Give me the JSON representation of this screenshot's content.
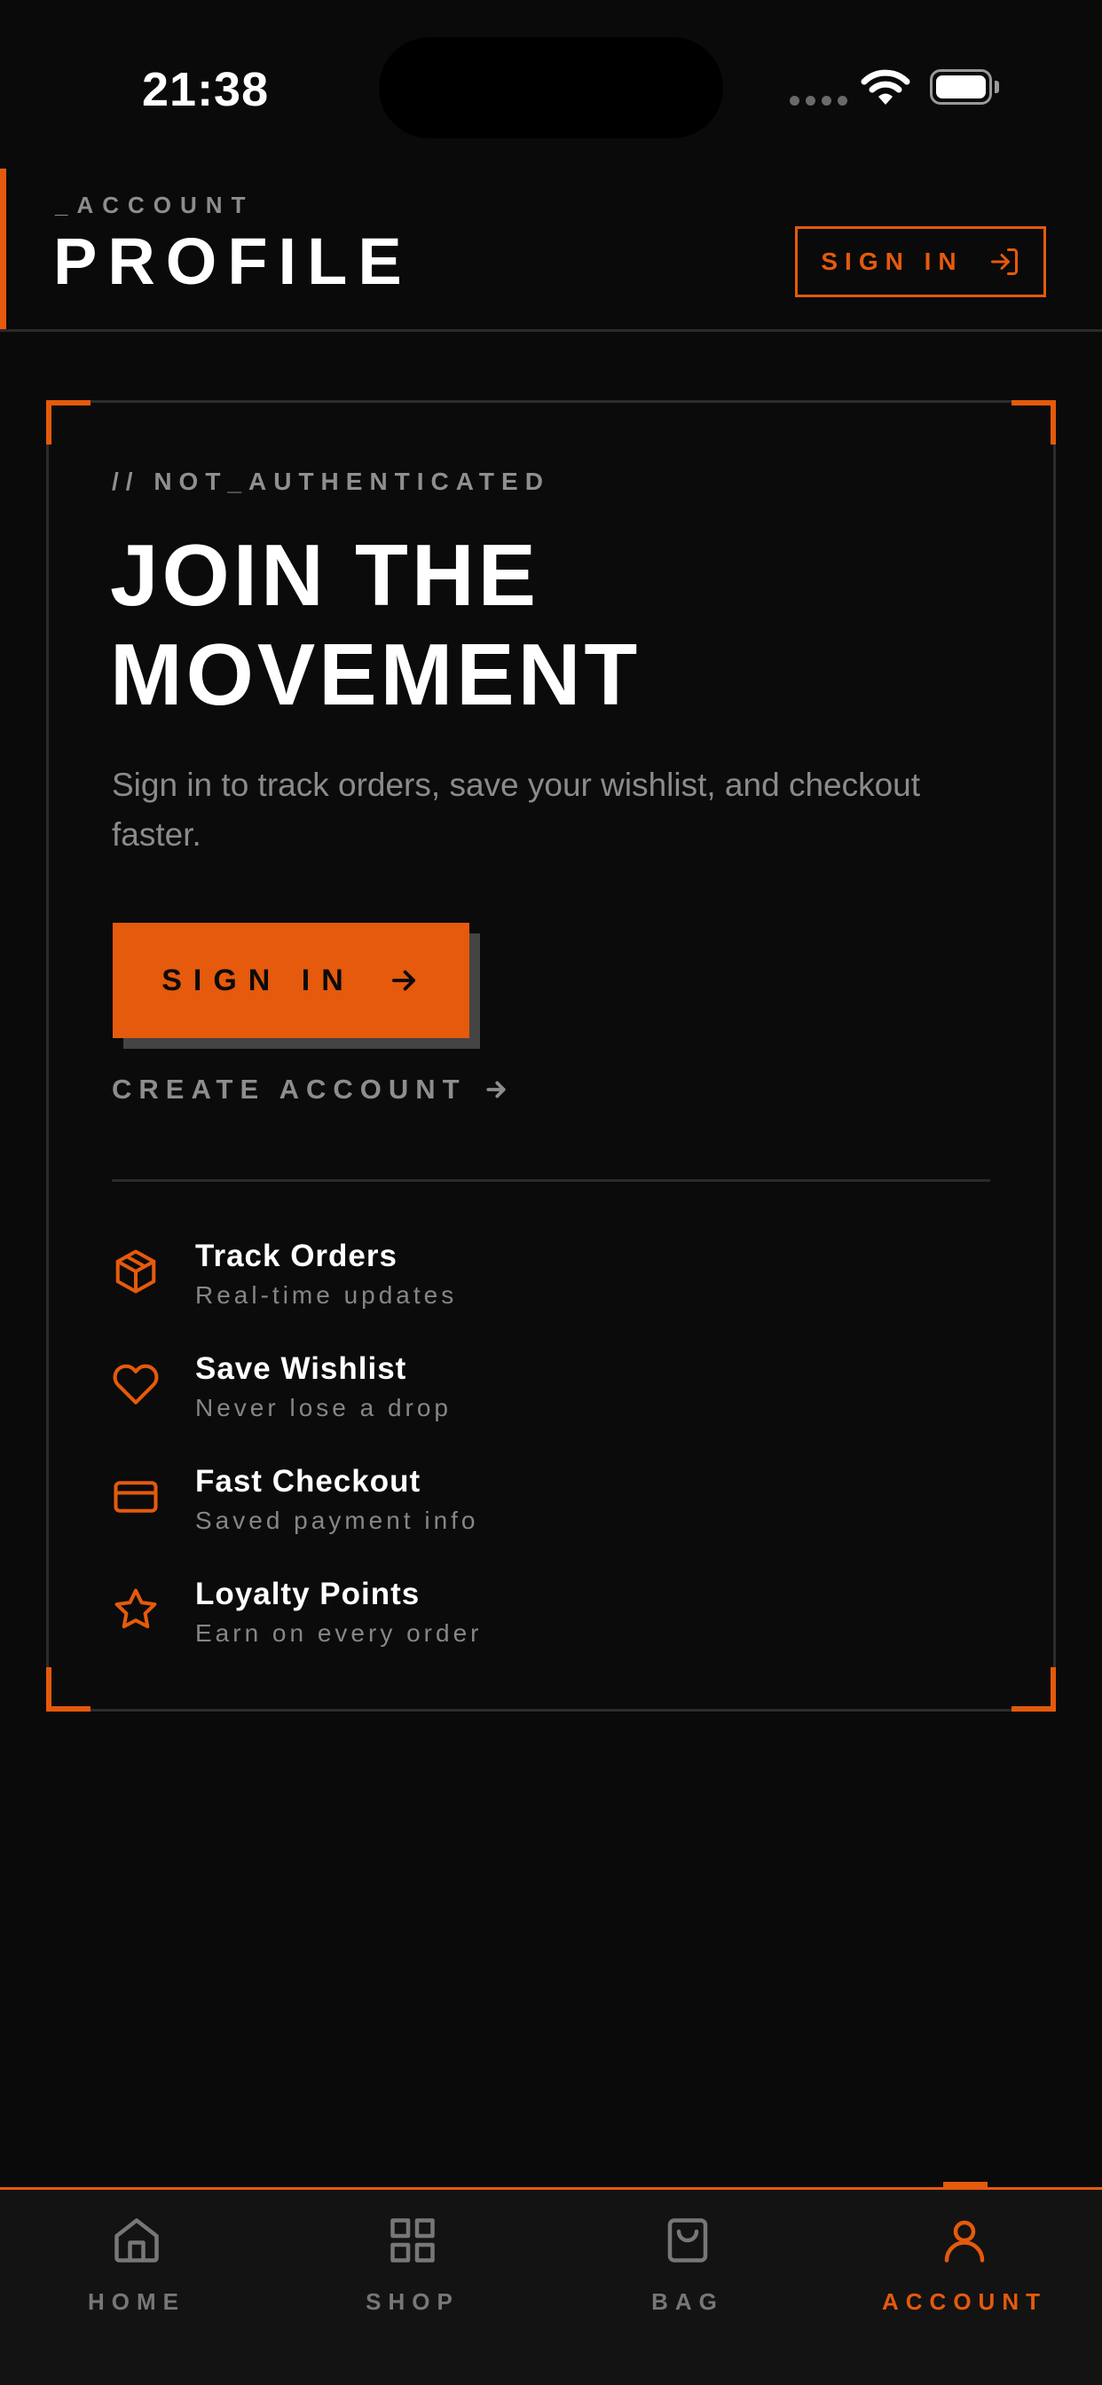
{
  "status_bar": {
    "time": "21:38"
  },
  "header": {
    "eyebrow": "_ACCOUNT",
    "title": "PROFILE",
    "signin_label": "SIGN IN"
  },
  "card": {
    "tag": "// NOT_AUTHENTICATED",
    "title_line1": "JOIN THE",
    "title_line2": "MOVEMENT",
    "subtitle": "Sign in to track orders, save your wishlist, and checkout faster.",
    "signin_label": "SIGN IN",
    "create_account_label": "CREATE ACCOUNT",
    "features": [
      {
        "icon": "package-icon",
        "title": "Track Orders",
        "desc": "Real-time updates"
      },
      {
        "icon": "heart-icon",
        "title": "Save Wishlist",
        "desc": "Never lose a drop"
      },
      {
        "icon": "credit-card-icon",
        "title": "Fast Checkout",
        "desc": "Saved payment info"
      },
      {
        "icon": "star-icon",
        "title": "Loyalty Points",
        "desc": "Earn on every order"
      }
    ]
  },
  "tabbar": {
    "active": "account",
    "tabs": [
      {
        "id": "home",
        "label": "HOME",
        "icon": "home-icon"
      },
      {
        "id": "shop",
        "label": "SHOP",
        "icon": "grid-icon"
      },
      {
        "id": "bag",
        "label": "BAG",
        "icon": "shopping-bag-icon"
      },
      {
        "id": "account",
        "label": "ACCOUNT",
        "icon": "user-icon"
      }
    ]
  },
  "colors": {
    "accent": "#e55a0c",
    "background": "#0a0a0a",
    "muted": "#8b8b8b"
  }
}
